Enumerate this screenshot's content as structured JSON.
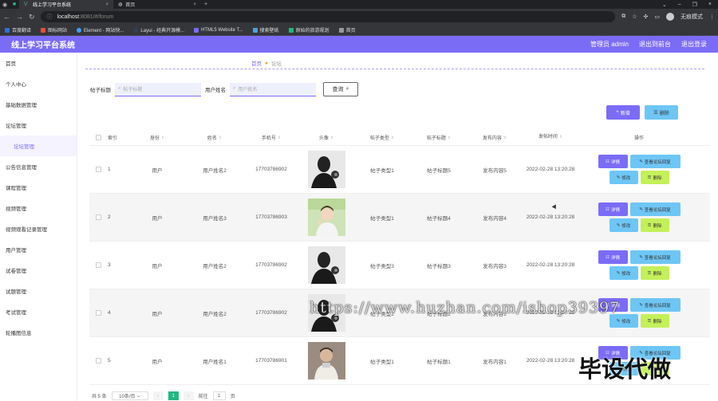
{
  "browser": {
    "tabs": [
      {
        "label": "线上学习平台系统",
        "active": true
      },
      {
        "label": "首页",
        "active": false
      }
    ],
    "url_host": "localhost",
    "url_rest": ":8081/#/forum",
    "profile_label": "无痕模式",
    "bookmarks": [
      {
        "label": "百度翻译",
        "color": "#2f6de1"
      },
      {
        "label": "图标网站",
        "color": "#e94c3d"
      },
      {
        "label": "Element - 网站快...",
        "color": "#409eff"
      },
      {
        "label": "Layui - 经典开源模...",
        "color": "#2f4056"
      },
      {
        "label": "HTML5 Website T...",
        "color": "#7b6cf6"
      },
      {
        "label": "搜索壁纸",
        "color": "#4aa3df"
      },
      {
        "label": "原始的旅游规划",
        "color": "#1fb980"
      },
      {
        "label": "首页",
        "color": "#999999"
      }
    ]
  },
  "header": {
    "title": "线上学习平台系统",
    "admin_label": "管理员 admin",
    "back_label": "退出到前台",
    "logout_label": "退出登录"
  },
  "sidebar": {
    "items": [
      {
        "label": "首页",
        "sub": false
      },
      {
        "label": "个人中心",
        "sub": false
      },
      {
        "label": "基础数据管理",
        "sub": false
      },
      {
        "label": "论坛管理",
        "sub": false
      },
      {
        "label": "论坛管理",
        "sub": true
      },
      {
        "label": "公告信息管理",
        "sub": false
      },
      {
        "label": "课程管理",
        "sub": false
      },
      {
        "label": "视频管理",
        "sub": false
      },
      {
        "label": "视频观看记录管理",
        "sub": false
      },
      {
        "label": "用户管理",
        "sub": false
      },
      {
        "label": "试卷管理",
        "sub": false
      },
      {
        "label": "试题管理",
        "sub": false
      },
      {
        "label": "考试管理",
        "sub": false
      },
      {
        "label": "轮播图信息",
        "sub": false
      }
    ]
  },
  "breadcrumb": {
    "home": "首页",
    "current": "论坛"
  },
  "search": {
    "title_label": "帖子标题",
    "title_placeholder": "帖子标题",
    "user_label": "用户姓名",
    "user_placeholder": "用户姓名",
    "button_label": "查询"
  },
  "toolbar": {
    "add_label": "新增",
    "delete_label": "删除"
  },
  "table": {
    "headers": [
      "索引",
      "身份",
      "姓名",
      "手机号",
      "头像",
      "帖子类型",
      "帖子标题",
      "发布内容",
      "发帖时间",
      "操作"
    ],
    "ops": {
      "detail": "详情",
      "reply": "查看论坛回复",
      "edit": "修改",
      "delete": "删除"
    },
    "rows": [
      {
        "index": "1",
        "role": "用户",
        "name": "用户姓名2",
        "phone": "17703786902",
        "avatar": "dark",
        "type": "帖子类型1",
        "title": "帖子标题5",
        "content": "发布内容5",
        "time": "2022-02-28 13:20:28"
      },
      {
        "index": "2",
        "role": "用户",
        "name": "用户姓名3",
        "phone": "17703786903",
        "avatar": "light",
        "type": "帖子类型1",
        "title": "帖子标题4",
        "content": "发布内容4",
        "time": "2022-02-28 13:20:28"
      },
      {
        "index": "3",
        "role": "用户",
        "name": "用户姓名2",
        "phone": "17703786902",
        "avatar": "dark",
        "type": "帖子类型3",
        "title": "帖子标题3",
        "content": "发布内容3",
        "time": "2022-02-28 13:20:28"
      },
      {
        "index": "4",
        "role": "用户",
        "name": "用户姓名2",
        "phone": "17703786902",
        "avatar": "dark",
        "type": "帖子类型2",
        "title": "帖子标题2",
        "content": "发布内容2",
        "time": "2022-02-28 13:20:28"
      },
      {
        "index": "5",
        "role": "用户",
        "name": "用户姓名1",
        "phone": "17703786901",
        "avatar": "portrait",
        "type": "帖子类型1",
        "title": "帖子标题1",
        "content": "发布内容1",
        "time": "2022-02-28 13:20:28"
      }
    ]
  },
  "pager": {
    "total": "共 5 条",
    "size": "10条/页",
    "page": "1",
    "goto_label": "前往",
    "goto_value": "1",
    "page_suffix": "页"
  },
  "watermark": {
    "url": "https://www.huzhan.com/ishop39397",
    "cn": "毕设代做"
  }
}
